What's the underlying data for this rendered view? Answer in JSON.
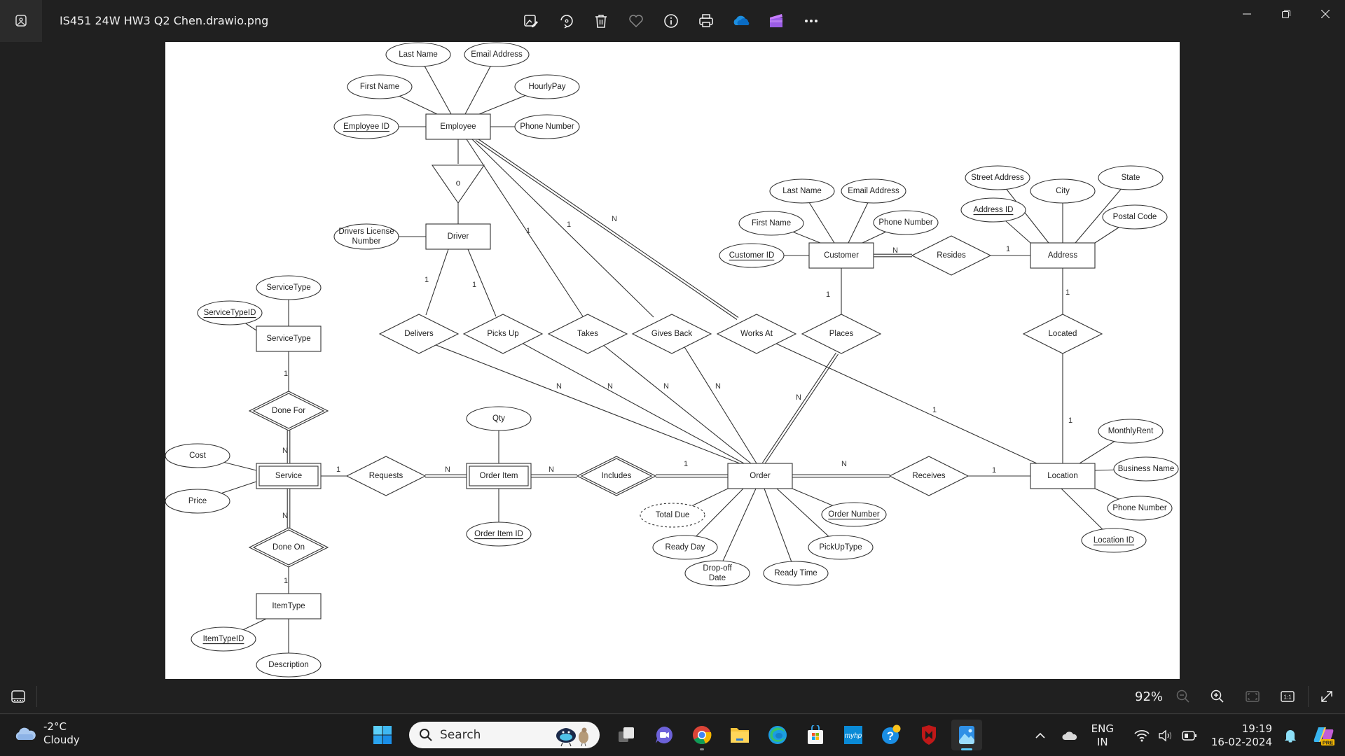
{
  "window": {
    "title": "IS451 24W HW3 Q2 Chen.drawio.png",
    "toolbar": [
      {
        "name": "edit-image",
        "icon": "edit-image-icon"
      },
      {
        "name": "rotate",
        "icon": "rotate-icon"
      },
      {
        "name": "delete",
        "icon": "trash-icon"
      },
      {
        "name": "favorite",
        "icon": "heart-icon"
      },
      {
        "name": "file-info",
        "icon": "info-icon"
      },
      {
        "name": "print",
        "icon": "printer-icon"
      },
      {
        "name": "onedrive",
        "icon": "onedrive-cloud-icon"
      },
      {
        "name": "clipchamp",
        "icon": "clipchamp-icon"
      },
      {
        "name": "more",
        "icon": "more-dots-icon"
      }
    ],
    "controls": [
      "minimize",
      "restore",
      "close"
    ]
  },
  "diagram": {
    "entities": {
      "employee": "Employee",
      "driver": "Driver",
      "customer": "Customer",
      "address": "Address",
      "servicetype": "ServiceType",
      "service": "Service",
      "itemtype": "ItemType",
      "orderitem": "Order Item",
      "order": "Order",
      "location": "Location"
    },
    "relationships": {
      "delivers": "Delivers",
      "picksup": "Picks Up",
      "takes": "Takes",
      "givesback": "Gives Back",
      "worksat": "Works At",
      "places": "Places",
      "located": "Located",
      "resides": "Resides",
      "donefor": "Done For",
      "doneon": "Done On",
      "requests": "Requests",
      "includes": "Includes",
      "receives": "Receives"
    },
    "specialization": "o",
    "attributes": {
      "emp_lastname": "Last Name",
      "emp_email": "Email Address",
      "emp_firstname": "First Name",
      "emp_hourlypay": "HourlyPay",
      "emp_id": "Employee ID",
      "emp_phone": "Phone Number",
      "drv_license_1": "Drivers License",
      "drv_license_2": "Number",
      "cus_lastname": "Last Name",
      "cus_email": "Email Address",
      "cus_firstname": "First Name",
      "cus_phone": "Phone Number",
      "cus_id": "Customer ID",
      "adr_street": "Street Address",
      "adr_city": "City",
      "adr_state": "State",
      "adr_id": "Address ID",
      "adr_postal": "Postal Code",
      "st_name": "ServiceType",
      "st_id": "ServiceTypeID",
      "svc_cost": "Cost",
      "svc_price": "Price",
      "it_id": "ItemTypeID",
      "it_desc": "Description",
      "oi_qty": "Qty",
      "oi_id": "Order Item ID",
      "ord_totaldue": "Total Due",
      "ord_number": "Order Number",
      "ord_readyday": "Ready Day",
      "ord_pickuptype": "PickUpType",
      "ord_dropoff_1": "Drop-off",
      "ord_dropoff_2": "Date",
      "ord_readytime": "Ready Time",
      "loc_rent": "MonthlyRent",
      "loc_bizname": "Business Name",
      "loc_phone": "Phone Number",
      "loc_id": "Location ID"
    },
    "cardinalities": {
      "emp_takes": "1",
      "emp_givesback": "1",
      "emp_worksat": "N",
      "drv_delivers": "1",
      "drv_picksup": "1",
      "st_donefor": "1",
      "svc_donefor": "N",
      "svc_doneon": "N",
      "it_doneon": "1",
      "svc_requests": "1",
      "oi_requests": "N",
      "oi_includes": "N",
      "ord_includes": "1",
      "ord_delivers": "N",
      "ord_picksup": "N",
      "ord_takes": "N",
      "ord_givesback": "N",
      "ord_places": "N",
      "cus_places": "1",
      "cus_resides": "N",
      "adr_resides": "1",
      "adr_located": "1",
      "loc_located": "1",
      "loc_worksat": "1",
      "ord_receives": "N",
      "loc_receives": "1"
    }
  },
  "bottombar": {
    "zoom_level": "92%",
    "buttons": [
      "zoom-out",
      "zoom-in",
      "fit-to-window",
      "actual-size",
      "full-screen"
    ]
  },
  "taskbar": {
    "weather": {
      "temp": "-2°C",
      "condition": "Cloudy"
    },
    "search_placeholder": "Search",
    "apps": [
      "start",
      "task-view",
      "teams-meet",
      "chrome",
      "file-explorer",
      "edge",
      "microsoft-store",
      "myhp",
      "get-help",
      "mcafee",
      "photos"
    ],
    "language": {
      "line1": "ENG",
      "line2": "IN"
    },
    "time": "19:19",
    "date": "16-02-2024",
    "copilot_badge": "PRE"
  }
}
